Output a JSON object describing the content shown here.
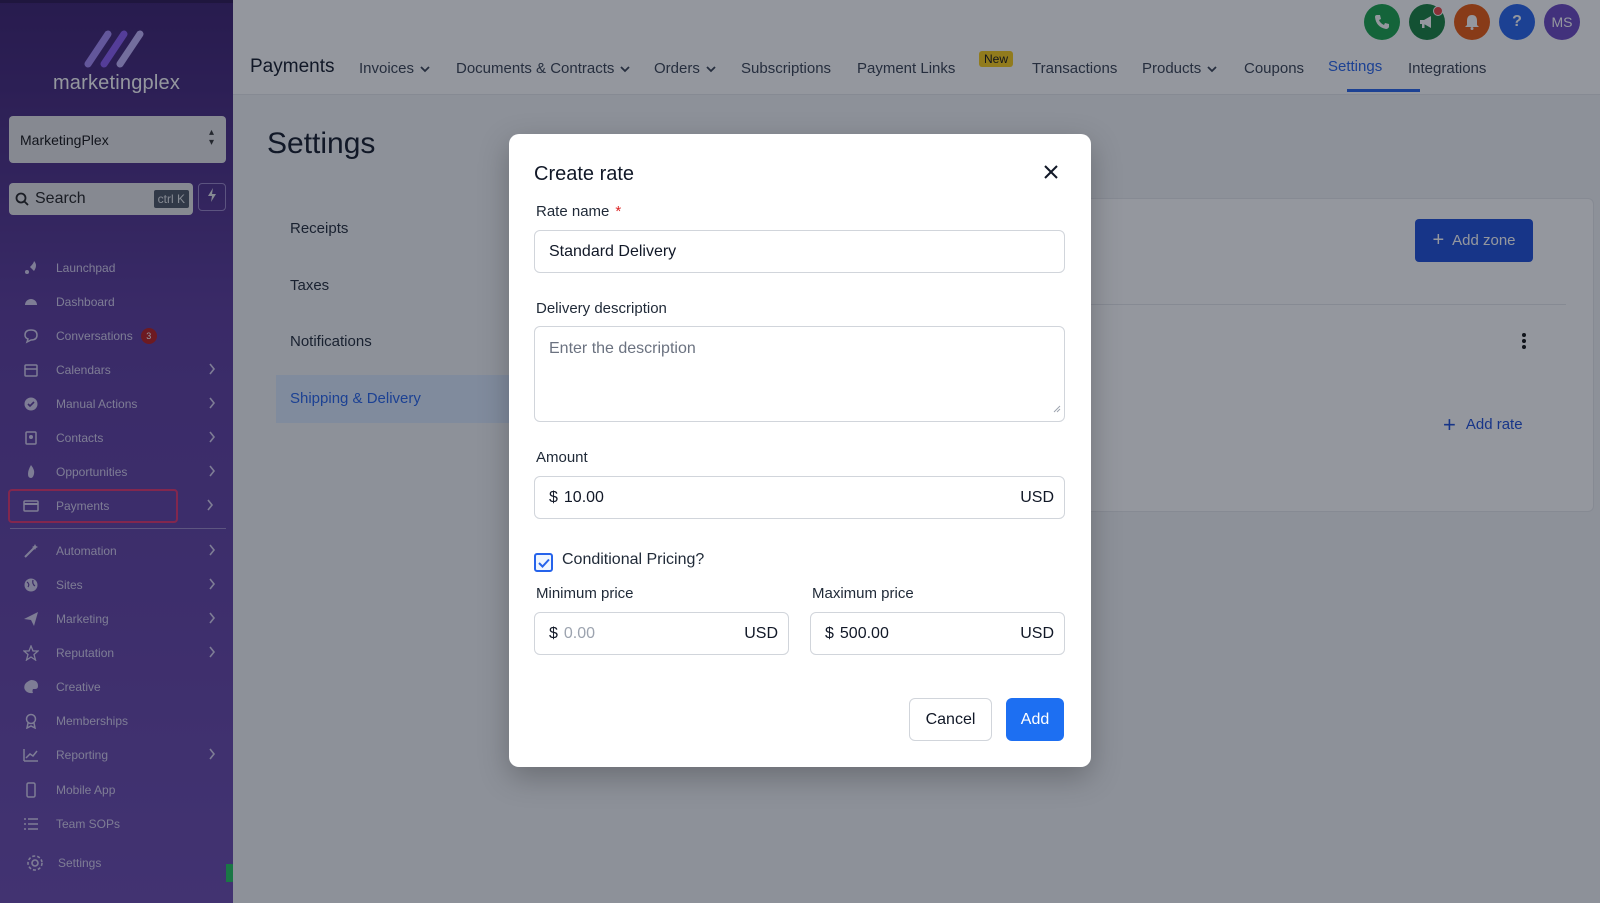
{
  "sidebar": {
    "logo_text": "marketingplex",
    "location": "MarketingPlex",
    "search_label": "Search",
    "search_shortcut": "ctrl K",
    "items": [
      {
        "label": "Launchpad",
        "icon": "rocket-icon",
        "chevron": false
      },
      {
        "label": "Dashboard",
        "icon": "gauge-icon",
        "chevron": false
      },
      {
        "label": "Conversations",
        "icon": "chat-icon",
        "chevron": false,
        "badge": "3"
      },
      {
        "label": "Calendars",
        "icon": "calendar-icon",
        "chevron": true
      },
      {
        "label": "Manual Actions",
        "icon": "check-circle-icon",
        "chevron": true
      },
      {
        "label": "Contacts",
        "icon": "contact-card-icon",
        "chevron": true
      },
      {
        "label": "Opportunities",
        "icon": "flame-icon",
        "chevron": true
      },
      {
        "label": "Payments",
        "icon": "credit-card-icon",
        "chevron": true,
        "highlighted": true
      },
      {
        "label": "Automation",
        "icon": "wand-icon",
        "chevron": true
      },
      {
        "label": "Sites",
        "icon": "globe-icon",
        "chevron": true
      },
      {
        "label": "Marketing",
        "icon": "paper-plane-icon",
        "chevron": true
      },
      {
        "label": "Reputation",
        "icon": "star-icon",
        "chevron": true
      },
      {
        "label": "Creative",
        "icon": "palette-icon",
        "chevron": false
      },
      {
        "label": "Memberships",
        "icon": "award-icon",
        "chevron": false
      },
      {
        "label": "Reporting",
        "icon": "chart-line-icon",
        "chevron": true
      },
      {
        "label": "Mobile App",
        "icon": "phone-icon",
        "chevron": false
      },
      {
        "label": "Team SOPs",
        "icon": "list-icon",
        "chevron": false
      }
    ],
    "settings_label": "Settings"
  },
  "topbar": {
    "app_title": "Payments",
    "tabs": [
      {
        "label": "Invoices",
        "dropdown": true
      },
      {
        "label": "Documents & Contracts",
        "dropdown": true
      },
      {
        "label": "Orders",
        "dropdown": true
      },
      {
        "label": "Subscriptions",
        "dropdown": false
      },
      {
        "label": "Payment Links",
        "dropdown": false
      },
      {
        "label": "Transactions",
        "dropdown": false
      },
      {
        "label": "Products",
        "dropdown": true
      },
      {
        "label": "Coupons",
        "dropdown": false
      },
      {
        "label": "Settings",
        "dropdown": false,
        "active": true
      },
      {
        "label": "Integrations",
        "dropdown": false
      }
    ],
    "new_badge": "New",
    "avatar_initials": "MS",
    "colors": {
      "phone": "#16a34a",
      "announce": "#15803d",
      "bell": "#ea580c",
      "help": "#2563eb",
      "avatar": "#6b46c1"
    }
  },
  "page": {
    "title": "Settings",
    "subnav": [
      "Receipts",
      "Taxes",
      "Notifications",
      "Shipping & Delivery"
    ],
    "add_zone_label": "Add zone",
    "add_rate_label": "Add rate"
  },
  "modal": {
    "title": "Create rate",
    "rate_name_label": "Rate name",
    "required_mark": "*",
    "rate_name_value": "Standard Delivery",
    "description_label": "Delivery description",
    "description_placeholder": "Enter the description",
    "amount_label": "Amount",
    "currency_symbol": "$",
    "amount_value": "10.00",
    "currency": "USD",
    "conditional_label": "Conditional Pricing?",
    "conditional_checked": true,
    "min_label": "Minimum price",
    "min_placeholder": "0.00",
    "max_label": "Maximum price",
    "max_value": "500.00",
    "cancel_label": "Cancel",
    "add_label": "Add"
  }
}
